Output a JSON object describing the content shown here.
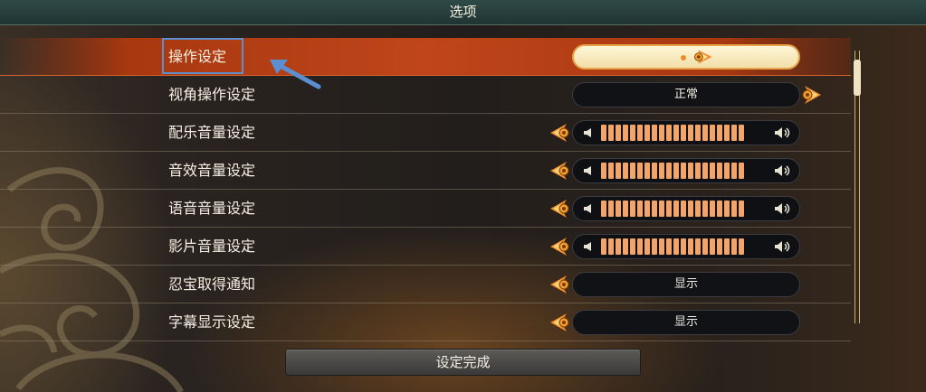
{
  "window": {
    "title": "选项"
  },
  "rows": [
    {
      "label": "操作设定",
      "type": "cursor"
    },
    {
      "label": "视角操作设定",
      "type": "select",
      "value": "正常"
    },
    {
      "label": "配乐音量设定",
      "type": "volume",
      "level": 20,
      "max": 20
    },
    {
      "label": "音效音量设定",
      "type": "volume",
      "level": 20,
      "max": 20
    },
    {
      "label": "语音音量设定",
      "type": "volume",
      "level": 20,
      "max": 20
    },
    {
      "label": "影片音量设定",
      "type": "volume",
      "level": 20,
      "max": 20
    },
    {
      "label": "忍宝取得通知",
      "type": "select",
      "value": "显示"
    },
    {
      "label": "字幕显示设定",
      "type": "select",
      "value": "显示"
    }
  ],
  "footer": {
    "done_label": "设定完成"
  },
  "scrollbar": {
    "position": 0
  },
  "colors": {
    "selected_row": "#c0451a",
    "accent_orange": "#f08a2a",
    "volume_bar": "#f3a46a",
    "annotation_blue": "#5b8fd1"
  },
  "icons": {
    "left_arrow": "left-chevron-orb-icon",
    "right_arrow": "right-chevron-orb-icon",
    "speaker_low": "speaker-low-icon",
    "speaker_high": "speaker-high-icon"
  }
}
